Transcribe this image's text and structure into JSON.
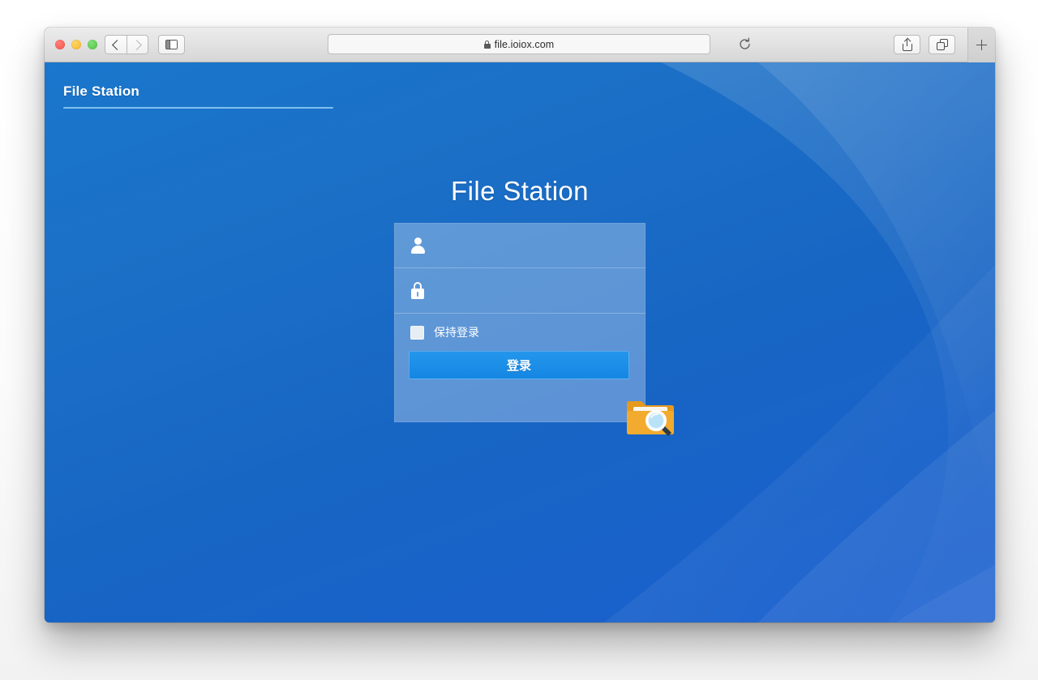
{
  "browser": {
    "traffic_lights": [
      "close",
      "minimize",
      "maximize"
    ],
    "nav": {
      "back_icon": "chevron-left-icon",
      "forward_icon": "chevron-right-icon",
      "sidebar_icon": "sidebar-toggle-icon"
    },
    "address_bar": {
      "lock_icon": "lock-icon",
      "url": "file.ioiox.com",
      "reload_icon": "reload-icon"
    },
    "actions": {
      "share_icon": "share-icon",
      "tabs_icon": "tabs-icon",
      "new_tab_label": "+"
    }
  },
  "page": {
    "header": {
      "app_name": "File Station"
    },
    "login": {
      "title": "File Station",
      "username": {
        "icon": "user-icon",
        "value": "",
        "placeholder": ""
      },
      "password": {
        "icon": "lock-icon",
        "value": "",
        "placeholder": ""
      },
      "remember": {
        "label": "保持登录",
        "checked": false
      },
      "submit_label": "登录",
      "brand_icon": "folder-search-icon"
    },
    "colors": {
      "background_top": "#1a77cc",
      "background_bottom": "#1a5fd0",
      "panel": "rgba(255,255,255,0.30)",
      "accent_button": "#1587e3",
      "header_rule": "#7fc0f0",
      "folder": "#f0a92a",
      "folder_lens": "#bfe4f7"
    }
  }
}
